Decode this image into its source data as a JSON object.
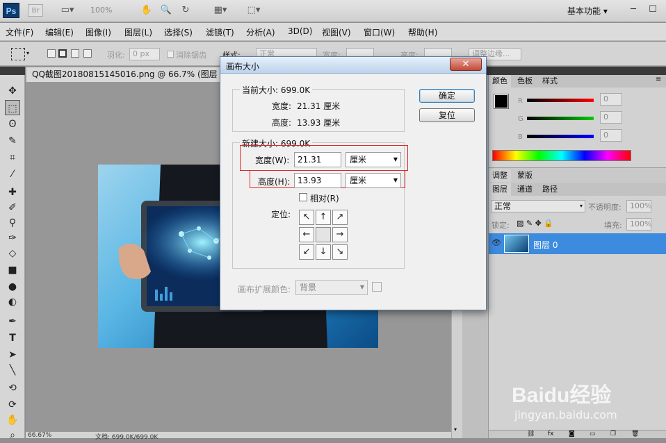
{
  "appbar": {
    "logo": "Ps",
    "bridge": "Br",
    "zoom": "100%",
    "workspace": "基本功能"
  },
  "menu": [
    "文件(F)",
    "编辑(E)",
    "图像(I)",
    "图层(L)",
    "选择(S)",
    "滤镜(T)",
    "分析(A)",
    "3D(D)",
    "视图(V)",
    "窗口(W)",
    "帮助(H)"
  ],
  "options": {
    "feather_label": "羽化:",
    "feather_value": "0 px",
    "antialias": "消除锯齿",
    "style_label": "样式:",
    "style_value": "正常",
    "width_label": "宽度:",
    "height_label": "高度:",
    "refine": "调整边缘..."
  },
  "document": {
    "tab": "QQ截图20180815145016.png @ 66.7% (图层 0, RG"
  },
  "status": {
    "zoom": "66.67%",
    "doc": "文档: 699.0K/699.0K"
  },
  "dialog": {
    "title": "画布大小",
    "ok": "确定",
    "reset": "复位",
    "current": {
      "label": "当前大小: 699.0K",
      "width_label": "宽度:",
      "width_value": "21.31 厘米",
      "height_label": "高度:",
      "height_value": "13.93 厘米"
    },
    "new": {
      "label": "新建大小: 699.0K",
      "width_label": "宽度(W):",
      "width_value": "21.31",
      "width_unit": "厘米",
      "height_label": "高度(H):",
      "height_value": "13.93",
      "height_unit": "厘米",
      "relative": "相对(R)",
      "anchor_label": "定位:"
    },
    "ext_color_label": "画布扩展颜色:",
    "ext_color_value": "背景"
  },
  "color_panel": {
    "tabs": [
      "颜色",
      "色板",
      "样式"
    ],
    "channels": [
      {
        "name": "R",
        "value": "0",
        "color": "#e02020"
      },
      {
        "name": "G",
        "value": "0",
        "color": "#20c020"
      },
      {
        "name": "B",
        "value": "0",
        "color": "#2030e0"
      }
    ]
  },
  "adj_panel": {
    "tabs": [
      "调整",
      "蒙版"
    ]
  },
  "layers_panel": {
    "tabs": [
      "图层",
      "通道",
      "路径"
    ],
    "blend": "正常",
    "opacity_label": "不透明度:",
    "opacity": "100%",
    "lock_label": "锁定:",
    "fill_label": "填充:",
    "fill": "100%",
    "layer_name": "图层 0"
  },
  "watermark": {
    "brand": "Baidu经验",
    "url": "jingyan.baidu.com"
  }
}
